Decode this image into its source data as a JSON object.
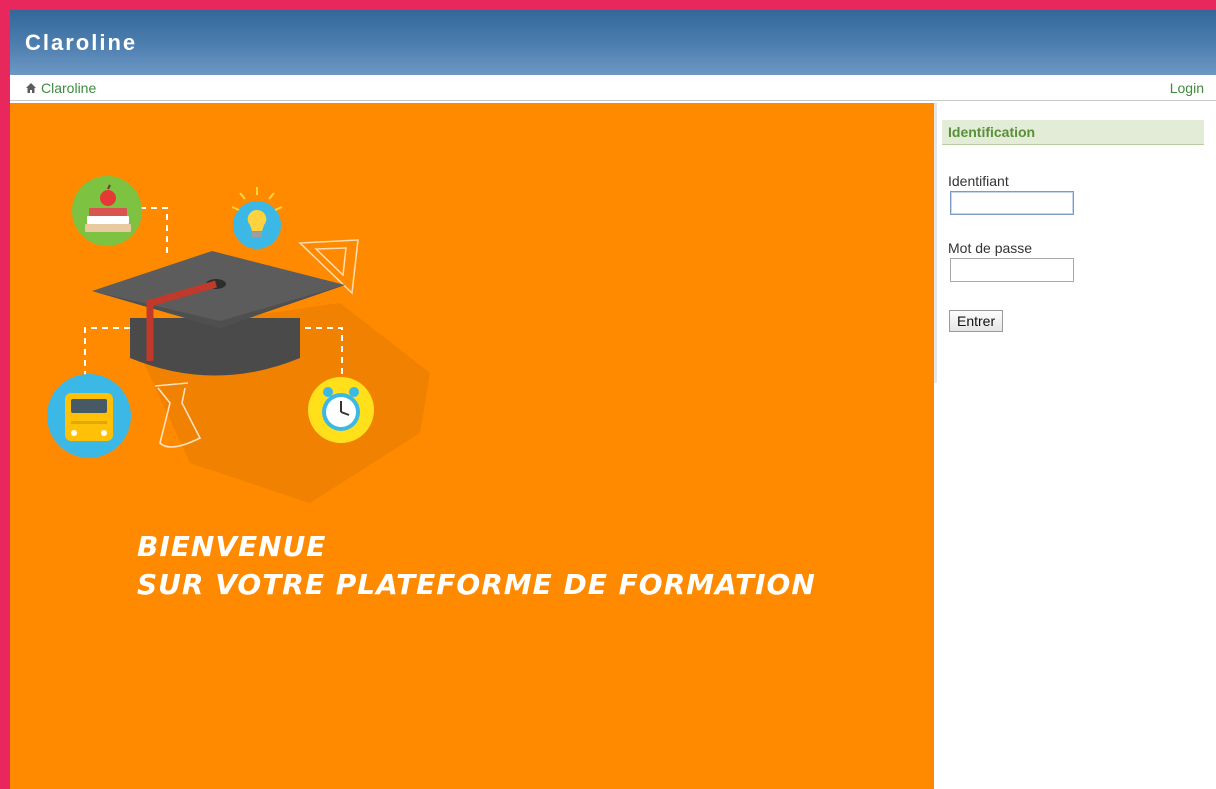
{
  "header": {
    "title": "Claroline"
  },
  "breadcrumb": {
    "home_label": "Claroline",
    "icon": "home-icon"
  },
  "topbar": {
    "login_label": "Login"
  },
  "hero": {
    "line1": "Bienvenue",
    "line2": "sur votre plateforme de formation",
    "background_color": "#ff8a00",
    "icons": [
      "graduation-cap-icon",
      "books-apple-icon",
      "lightbulb-icon",
      "set-square-icon",
      "school-bus-icon",
      "flask-icon",
      "alarm-clock-icon"
    ]
  },
  "login_panel": {
    "title": "Identification",
    "username_label": "Identifiant",
    "username_value": "",
    "password_label": "Mot de passe",
    "password_value": "",
    "submit_label": "Entrer"
  },
  "colors": {
    "frame": "#e8285c",
    "banner": "#4e7fb0",
    "link": "#3e8a3e",
    "panel_title": "#5a8f3a"
  }
}
